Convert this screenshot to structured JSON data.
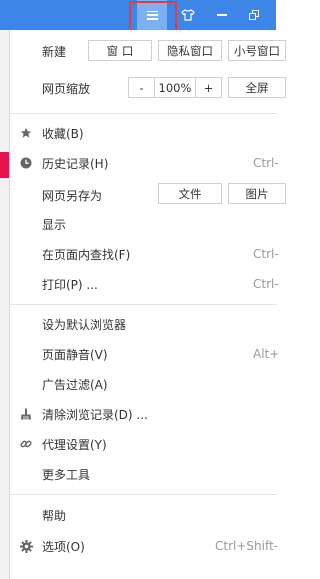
{
  "top": {
    "new_label": "新建",
    "new_window": "窗 口",
    "new_private": "隐私窗口",
    "new_small": "小号窗口",
    "zoom_label": "网页缩放",
    "zoom_minus": "-",
    "zoom_value": "100%",
    "zoom_plus": "+",
    "fullscreen": "全屏"
  },
  "save": {
    "label": "网页另存为",
    "file_btn": "文件",
    "image_btn": "图片"
  },
  "items": {
    "favorites": {
      "label": "收藏(B)",
      "icon": "star-icon"
    },
    "history": {
      "label": "历史记录(H)",
      "shortcut": "Ctrl-",
      "icon": "clock-icon"
    },
    "display": {
      "label": "显示"
    },
    "find": {
      "label": "在页面内查找(F)",
      "shortcut": "Ctrl-"
    },
    "print": {
      "label": "打印(P) ...",
      "shortcut": "Ctrl-"
    },
    "default_browser": {
      "label": "设为默认浏览器"
    },
    "mute": {
      "label": "页面静音(V)",
      "shortcut": "Alt+"
    },
    "adblock": {
      "label": "广告过滤(A)"
    },
    "clear_history": {
      "label": "清除浏览记录(D) ...",
      "icon": "broom-icon"
    },
    "proxy": {
      "label": "代理设置(Y)",
      "icon": "link-icon"
    },
    "more_tools": {
      "label": "更多工具"
    },
    "help": {
      "label": "帮助"
    },
    "options": {
      "label": "选项(O)",
      "shortcut": "Ctrl+Shift-",
      "icon": "gear-icon"
    }
  },
  "colors": {
    "titlebar": "#3d86e8",
    "menu_button_active": "#7cb0f2",
    "highlight_box": "#e23b3b",
    "page_accent": "#e8134d"
  }
}
